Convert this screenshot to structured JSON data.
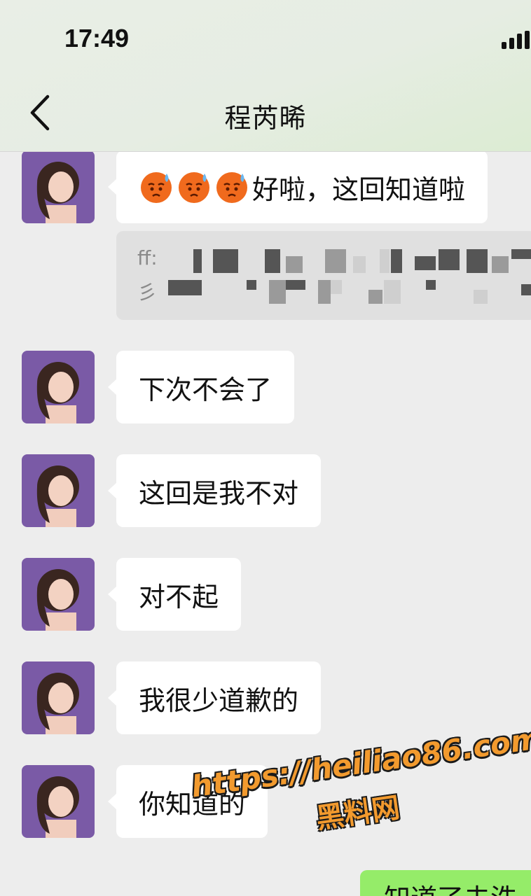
{
  "status_bar": {
    "time": "17:49"
  },
  "header": {
    "title": "程芮晞"
  },
  "messages": [
    {
      "text": "好啦，这回知道啦",
      "emoji_count": 3
    },
    {
      "quote_visible_prefix_1": "ff:",
      "quote_visible_prefix_2": "彡"
    },
    {
      "text": "下次不会了"
    },
    {
      "text": "这回是我不对"
    },
    {
      "text": "对不起"
    },
    {
      "text": "我很少道歉的"
    },
    {
      "text": "你知道的"
    }
  ],
  "sent_partial": "知道了去洗",
  "watermark": {
    "url": "https://heiliao86.com",
    "name": "黑料网"
  },
  "colors": {
    "incoming_bubble": "#ffffff",
    "outgoing_bubble": "#95ec69",
    "background": "#ededed",
    "watermark": "#f29a2e"
  }
}
